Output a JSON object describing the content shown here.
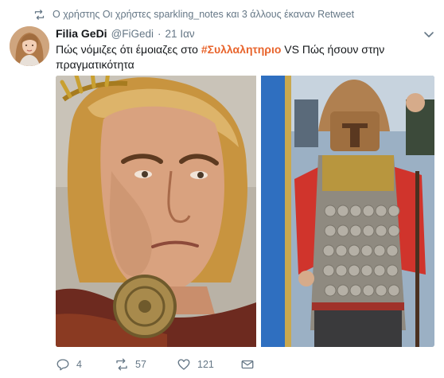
{
  "retweet_context": {
    "text": "Ο χρήστης Οι χρήστες sparkling_notes και 3 άλλους έκαναν Retweet",
    "icon": "retweet-icon"
  },
  "tweet": {
    "author_name": "Filia GeDi",
    "handle": "@FiGedi",
    "separator": "·",
    "time": "21 Ιαν",
    "text_before": "Πώς νόμιζες ότι έμοιαζες στο ",
    "hashtag": "#Συλλαλητηριο",
    "text_after": " VS Πώς ήσουν στην πραγματικότητα"
  },
  "actions": {
    "reply_count": "4",
    "retweet_count": "57",
    "like_count": "121"
  },
  "colors": {
    "hashtag": "#e8642c",
    "secondary_text": "#657786",
    "primary_text": "#14171a"
  }
}
